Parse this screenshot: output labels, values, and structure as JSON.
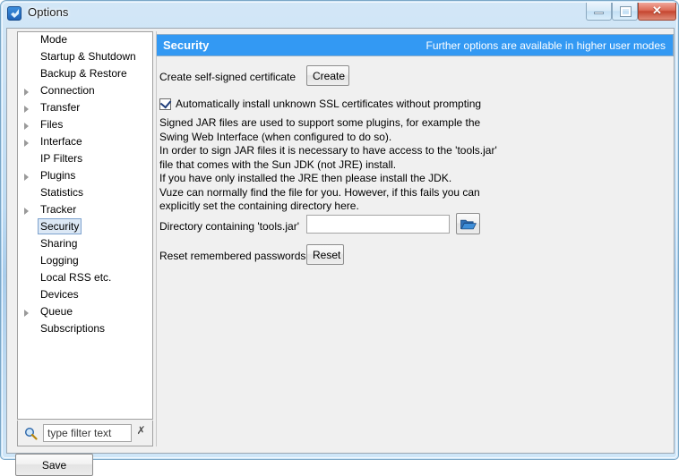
{
  "window": {
    "title": "Options",
    "app_icon": "vuze-icon",
    "controls": {
      "minimize": "minimize-icon",
      "maximize": "maximize-icon",
      "close": "✕"
    },
    "colors": {
      "titlebar": "#bedcf4",
      "accent": "#3399f3",
      "close_button": "#c54630",
      "client_bg": "#f0f0f0",
      "selection_bg": "#dce8f5",
      "selection_border": "#7da2ce"
    }
  },
  "sidebar": {
    "items": [
      {
        "label": "Mode",
        "expandable": false,
        "selected": false
      },
      {
        "label": "Startup & Shutdown",
        "expandable": false,
        "selected": false
      },
      {
        "label": "Backup & Restore",
        "expandable": false,
        "selected": false
      },
      {
        "label": "Connection",
        "expandable": true,
        "selected": false
      },
      {
        "label": "Transfer",
        "expandable": true,
        "selected": false
      },
      {
        "label": "Files",
        "expandable": true,
        "selected": false
      },
      {
        "label": "Interface",
        "expandable": true,
        "selected": false
      },
      {
        "label": "IP Filters",
        "expandable": false,
        "selected": false
      },
      {
        "label": "Plugins",
        "expandable": true,
        "selected": false
      },
      {
        "label": "Statistics",
        "expandable": false,
        "selected": false
      },
      {
        "label": "Tracker",
        "expandable": true,
        "selected": false
      },
      {
        "label": "Security",
        "expandable": false,
        "selected": true
      },
      {
        "label": "Sharing",
        "expandable": false,
        "selected": false
      },
      {
        "label": "Logging",
        "expandable": false,
        "selected": false
      },
      {
        "label": "Local RSS etc.",
        "expandable": false,
        "selected": false
      },
      {
        "label": "Devices",
        "expandable": false,
        "selected": false
      },
      {
        "label": "Queue",
        "expandable": true,
        "selected": false
      },
      {
        "label": "Subscriptions",
        "expandable": false,
        "selected": false
      }
    ],
    "filter": {
      "value": "",
      "placeholder": "type filter text",
      "search_icon": "search-icon",
      "clear_icon": "✗"
    },
    "save_label": "Save"
  },
  "main": {
    "header": {
      "title": "Security",
      "note": "Further options are available in higher user modes"
    },
    "certificate": {
      "label": "Create self-signed certificate",
      "button": "Create"
    },
    "auto_install": {
      "label": "Automatically install unknown SSL certificates without prompting",
      "checked": true
    },
    "description": [
      "Signed JAR files are used to support some plugins, for example the",
      "Swing Web Interface (when configured to do so).",
      "In order to sign JAR files it is necessary to have access to the 'tools.jar'",
      "file that comes with the Sun JDK (not JRE) install.",
      "If you have only installed the JRE then please install the JDK.",
      "Vuze can normally find the file for you. However, if this fails you can",
      "explicitly set the containing directory here."
    ],
    "directory": {
      "label": "Directory containing 'tools.jar'",
      "value": "",
      "placeholder": "",
      "browse_icon": "folder-open-icon"
    },
    "reset_passwords": {
      "label": "Reset remembered passwords",
      "button": "Reset"
    }
  }
}
